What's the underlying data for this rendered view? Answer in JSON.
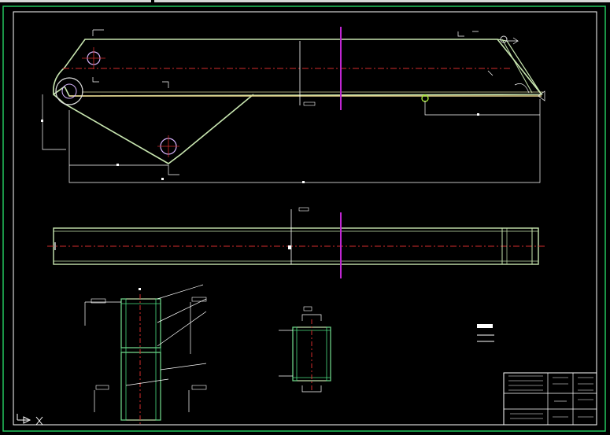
{
  "drawing": {
    "type": "CAD mechanical drawing (boom arm)",
    "background_color": "#000000",
    "colors": {
      "frame": "#22c55e",
      "outline": "#c8e6b0",
      "centerline": "#d22b2b",
      "cut_plane": "#c026d3",
      "dimension": "#ffffff",
      "hatch": "#4ade80",
      "hole": "#d8b4fe"
    },
    "icons": {
      "ucs": "ucs-axis-icon"
    }
  }
}
